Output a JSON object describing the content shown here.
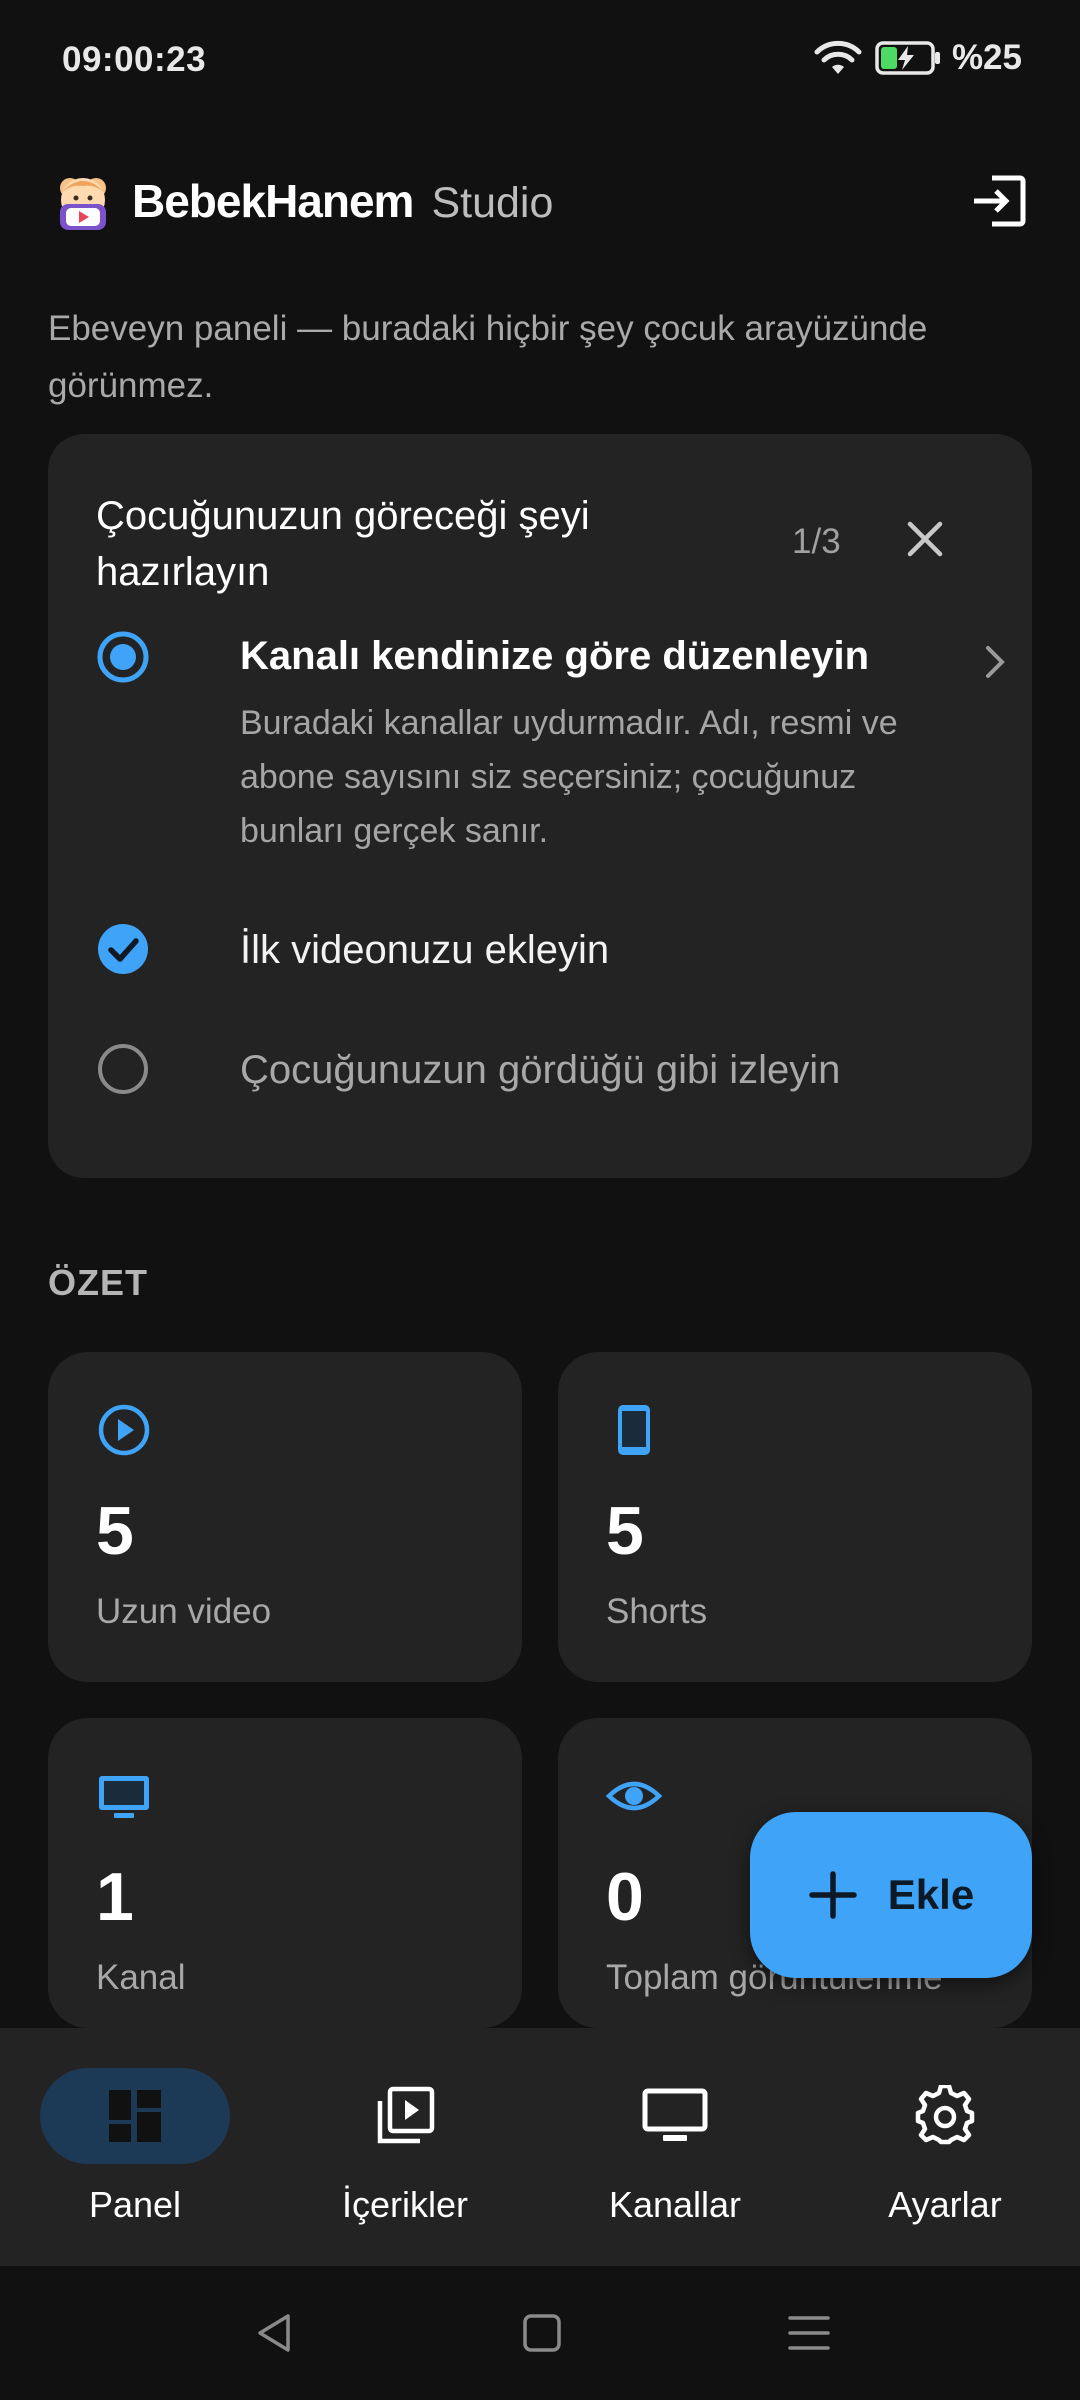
{
  "status_bar": {
    "time": "09:00:23",
    "battery_percent": "%25",
    "icons": [
      "wifi-icon",
      "battery-charging-icon"
    ]
  },
  "header": {
    "brand": "BebekHanem",
    "brand_suffix": "Studio",
    "logout_icon": "logout-icon"
  },
  "intro_text": "Ebeveyn paneli — buradaki hiçbir şey çocuk arayüzünde görünmez.",
  "onboarding": {
    "title": "Çocuğunuzun göreceği şeyi hazırlayın",
    "step": "1/3",
    "tasks": [
      {
        "label": "Kanalı kendinize göre düzenleyin",
        "description": "Buradaki kanallar uydurmadır. Adı, resmi ve abone sayısını siz seçersiniz; çocuğunuz bunları gerçek sanır.",
        "state": "current"
      },
      {
        "label": "İlk videonuzu ekleyin",
        "state": "done"
      },
      {
        "label": "Çocuğunuzun gördüğü gibi izleyin",
        "state": "todo"
      }
    ]
  },
  "summary": {
    "heading": "ÖZET",
    "stats": [
      {
        "value": "5",
        "label": "Uzun video",
        "icon": "play-circle-icon"
      },
      {
        "value": "5",
        "label": "Shorts",
        "icon": "phone-icon"
      },
      {
        "value": "1",
        "label": "Kanal",
        "icon": "tv-icon"
      },
      {
        "value": "0",
        "label": "Toplam görüntülenme",
        "icon": "eye-icon"
      }
    ]
  },
  "fab": {
    "label": "Ekle",
    "icon": "plus-icon"
  },
  "bottom_nav": {
    "items": [
      {
        "label": "Panel",
        "icon": "dashboard-icon",
        "active": true
      },
      {
        "label": "İçerikler",
        "icon": "video-library-icon",
        "active": false
      },
      {
        "label": "Kanallar",
        "icon": "monitor-icon",
        "active": false
      },
      {
        "label": "Ayarlar",
        "icon": "gear-icon",
        "active": false
      }
    ]
  },
  "colors": {
    "background": "#111111",
    "card": "#232323",
    "accent": "#3fa3f7",
    "nav_active": "#1c3a55"
  }
}
